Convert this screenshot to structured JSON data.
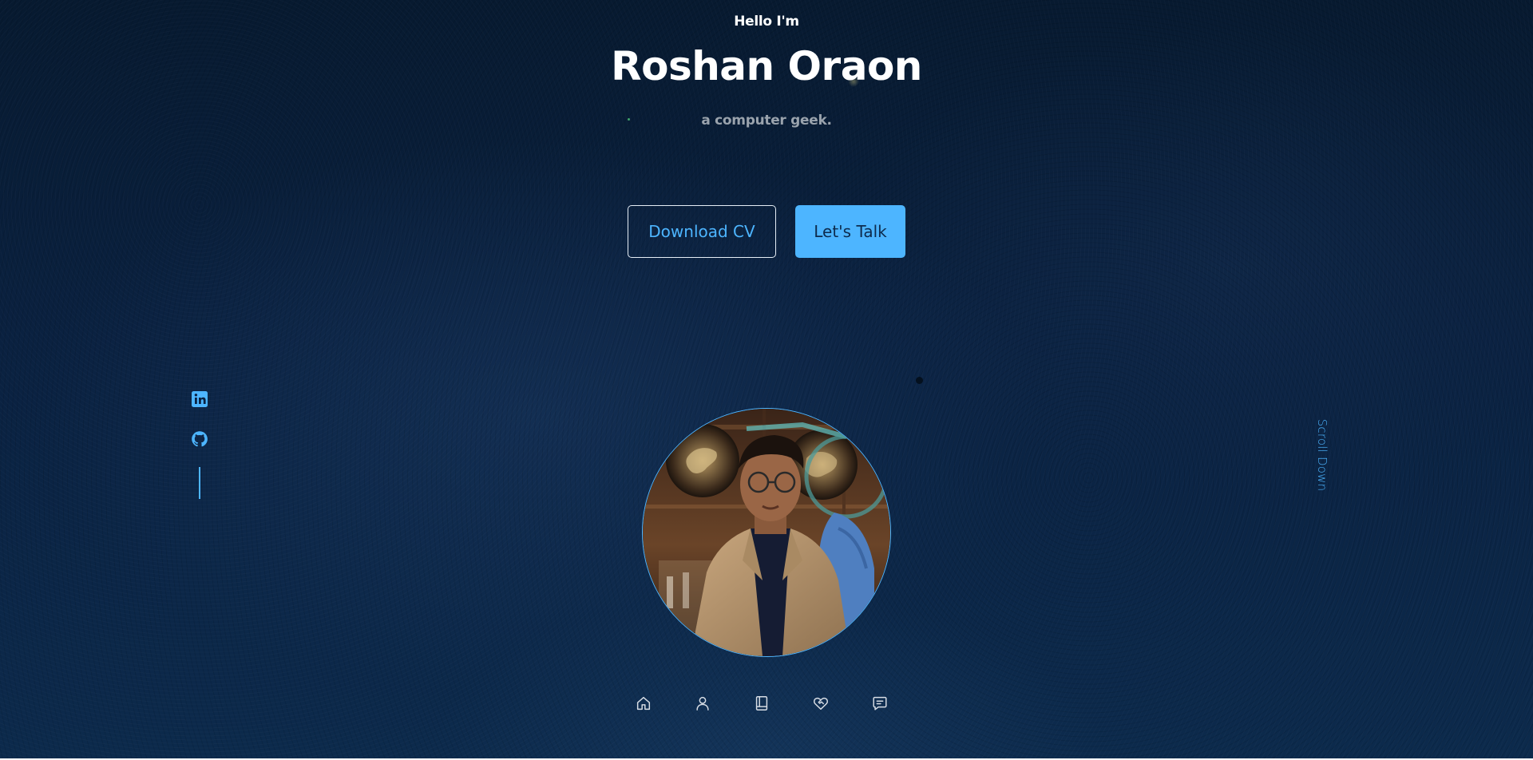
{
  "hero": {
    "greeting": "Hello I'm",
    "name": "Roshan Oraon",
    "tagline": "a computer geek."
  },
  "buttons": {
    "download_cv": "Download CV",
    "lets_talk": "Let's Talk"
  },
  "socials": [
    {
      "icon": "linkedin-icon"
    },
    {
      "icon": "github-icon"
    }
  ],
  "scroll_down": "Scroll Down",
  "nav": [
    {
      "icon": "home-icon"
    },
    {
      "icon": "user-icon"
    },
    {
      "icon": "book-icon"
    },
    {
      "icon": "heart-handshake-icon"
    },
    {
      "icon": "message-icon"
    }
  ],
  "colors": {
    "accent": "#4db5ff",
    "background": "#0a2140",
    "text": "#ffffff",
    "muted_text": "#9aa3ad"
  }
}
